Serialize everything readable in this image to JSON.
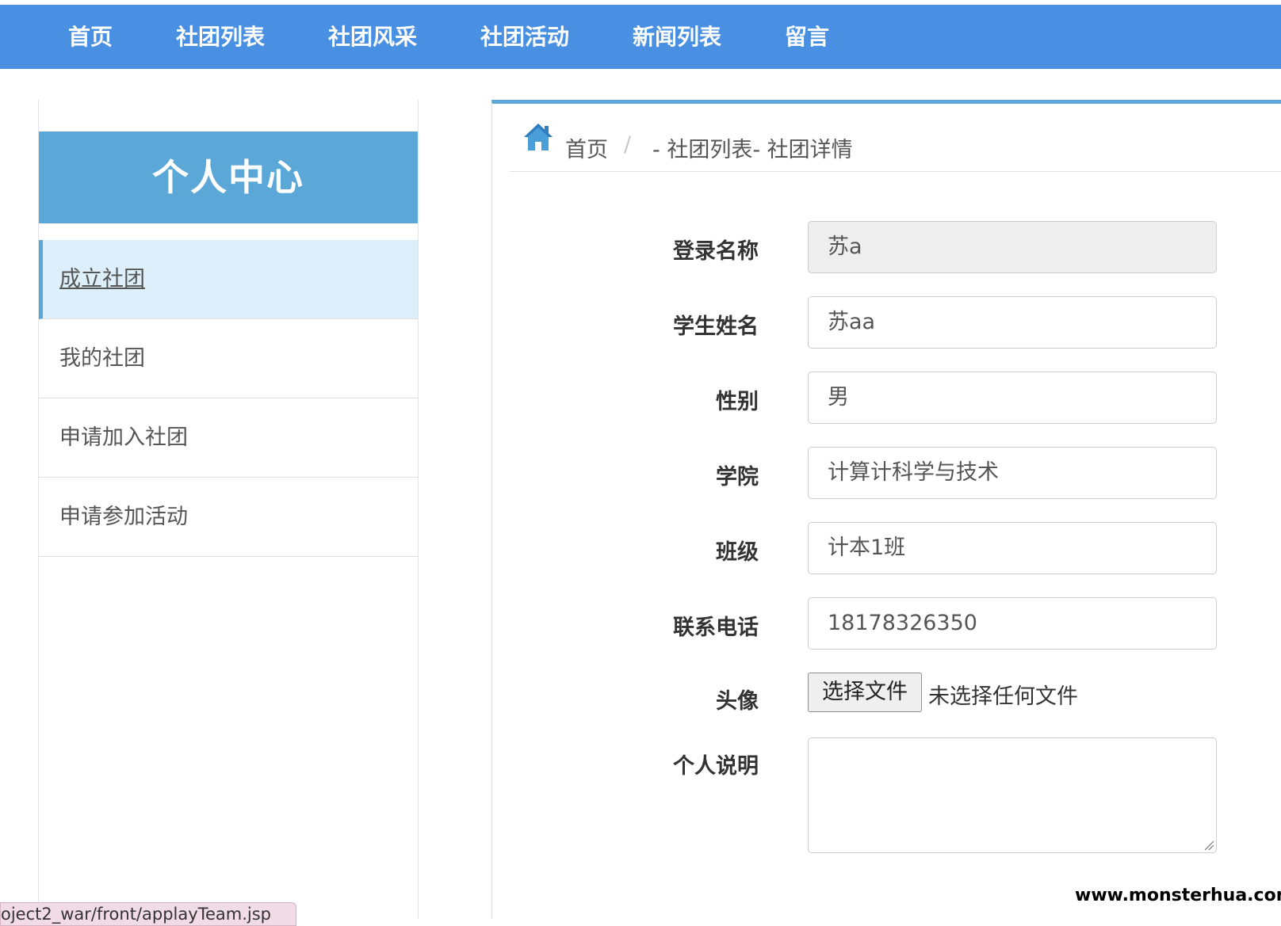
{
  "nav": {
    "items": [
      "首页",
      "社团列表",
      "社团风采",
      "社团活动",
      "新闻列表",
      "留言"
    ]
  },
  "sidebar": {
    "title": "个人中心",
    "items": [
      "成立社团",
      "我的社团",
      "申请加入社团",
      "申请参加活动"
    ],
    "active_index": 0
  },
  "breadcrumb": {
    "home": "首页",
    "separator": "/",
    "current": "- 社团列表- 社团详情"
  },
  "form": {
    "fields": [
      {
        "label": "登录名称",
        "value": "苏a",
        "readonly": true
      },
      {
        "label": "学生姓名",
        "value": "苏aa"
      },
      {
        "label": "性别",
        "value": "男"
      },
      {
        "label": "学院",
        "value": "计算计科学与技术"
      },
      {
        "label": "班级",
        "value": "计本1班"
      },
      {
        "label": "联系电话",
        "value": "18178326350"
      }
    ],
    "avatar": {
      "label": "头像",
      "button": "选择文件",
      "status": "未选择任何文件"
    },
    "description": {
      "label": "个人说明",
      "value": ""
    }
  },
  "status_url": "oject2_war/front/applayTeam.jsp",
  "watermark": "www.monsterhua.com",
  "colors": {
    "nav_bg": "#4a90e2",
    "sidebar_header": "#5ba8d8",
    "active_item_bg": "#ddeffb"
  }
}
